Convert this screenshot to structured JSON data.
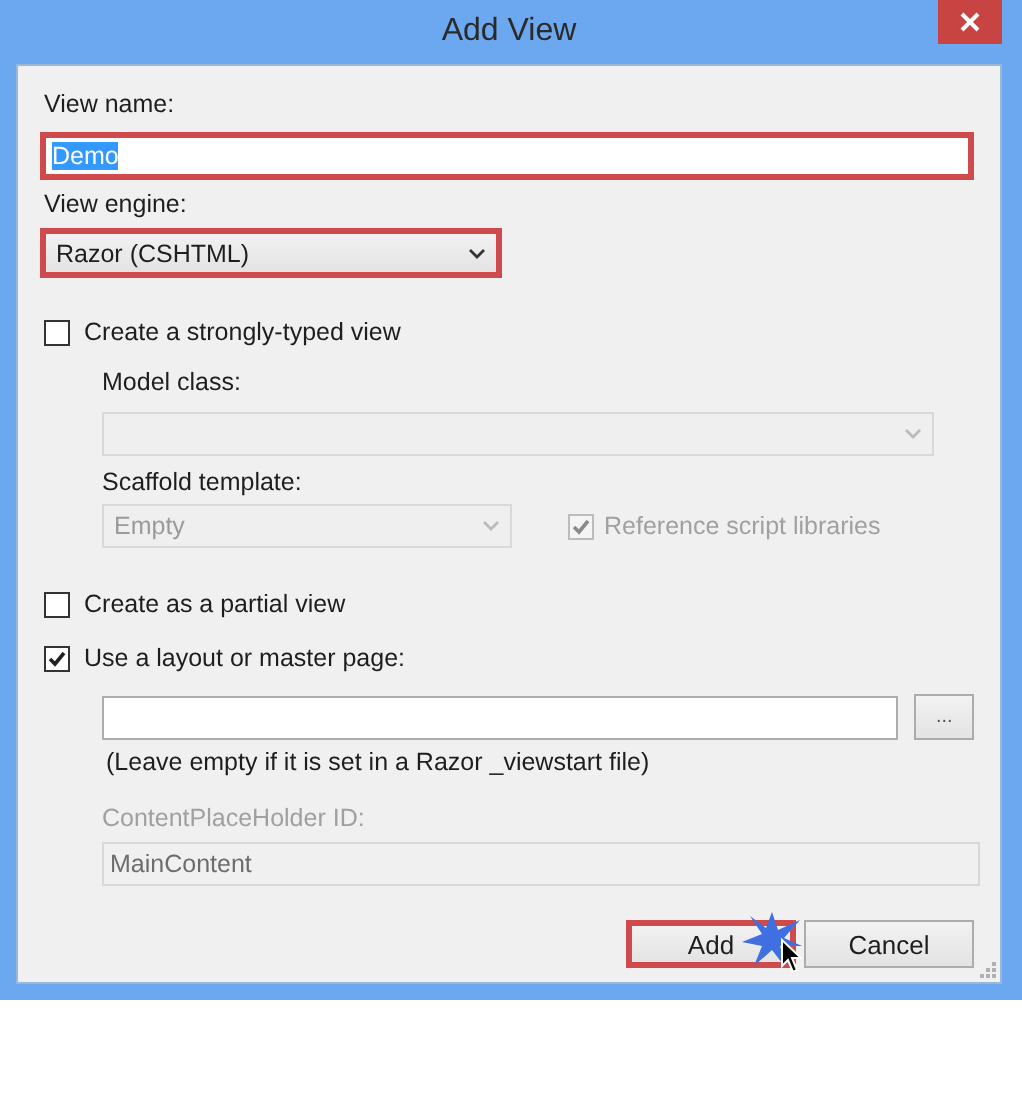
{
  "window": {
    "title": "Add View"
  },
  "view_name": {
    "label": "View name:",
    "value": "Demo",
    "text_selected": true,
    "highlighted": true
  },
  "view_engine": {
    "label": "View engine:",
    "value": "Razor (CSHTML)",
    "highlighted": true
  },
  "strongly_typed": {
    "label": "Create a strongly-typed view",
    "checked": false
  },
  "model_class": {
    "label": "Model class:",
    "disabled": true
  },
  "scaffold_template": {
    "label": "Scaffold template:",
    "value": "Empty",
    "disabled": true
  },
  "reference_scripts": {
    "label": "Reference script libraries",
    "checked": true,
    "disabled": true
  },
  "partial_view": {
    "label": "Create as a partial view",
    "checked": false
  },
  "use_layout": {
    "label": "Use a layout or master page:",
    "checked": true
  },
  "layout_path": {
    "browse": "..."
  },
  "hint": "(Leave empty if it is set in a Razor _viewstart file)",
  "placeholder_id": {
    "label": "ContentPlaceHolder ID:",
    "value": "MainContent",
    "disabled": true
  },
  "buttons": [
    {
      "label": "Add",
      "highlighted": true
    },
    {
      "label": "Cancel",
      "highlighted": false
    }
  ]
}
